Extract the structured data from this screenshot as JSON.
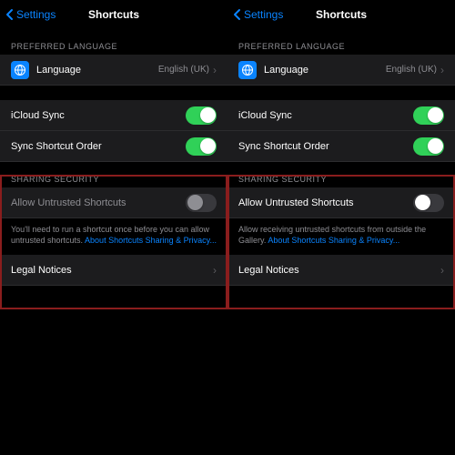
{
  "nav": {
    "back": "Settings",
    "title": "Shortcuts"
  },
  "sections": {
    "preferred_language_header": "PREFERRED LANGUAGE",
    "language_label": "Language",
    "language_value": "English (UK)",
    "icloud_sync_label": "iCloud Sync",
    "sync_order_label": "Sync Shortcut Order",
    "sharing_security_header": "SHARING SECURITY",
    "allow_untrusted_label": "Allow Untrusted Shortcuts",
    "legal_notices_label": "Legal Notices"
  },
  "left": {
    "footer_text": "You'll need to run a shortcut once before you can allow untrusted shortcuts. ",
    "footer_link": "About Shortcuts Sharing & Privacy..."
  },
  "right": {
    "footer_text": "Allow receiving untrusted shortcuts from outside the Gallery. ",
    "footer_link": "About Shortcuts Sharing & Privacy..."
  }
}
